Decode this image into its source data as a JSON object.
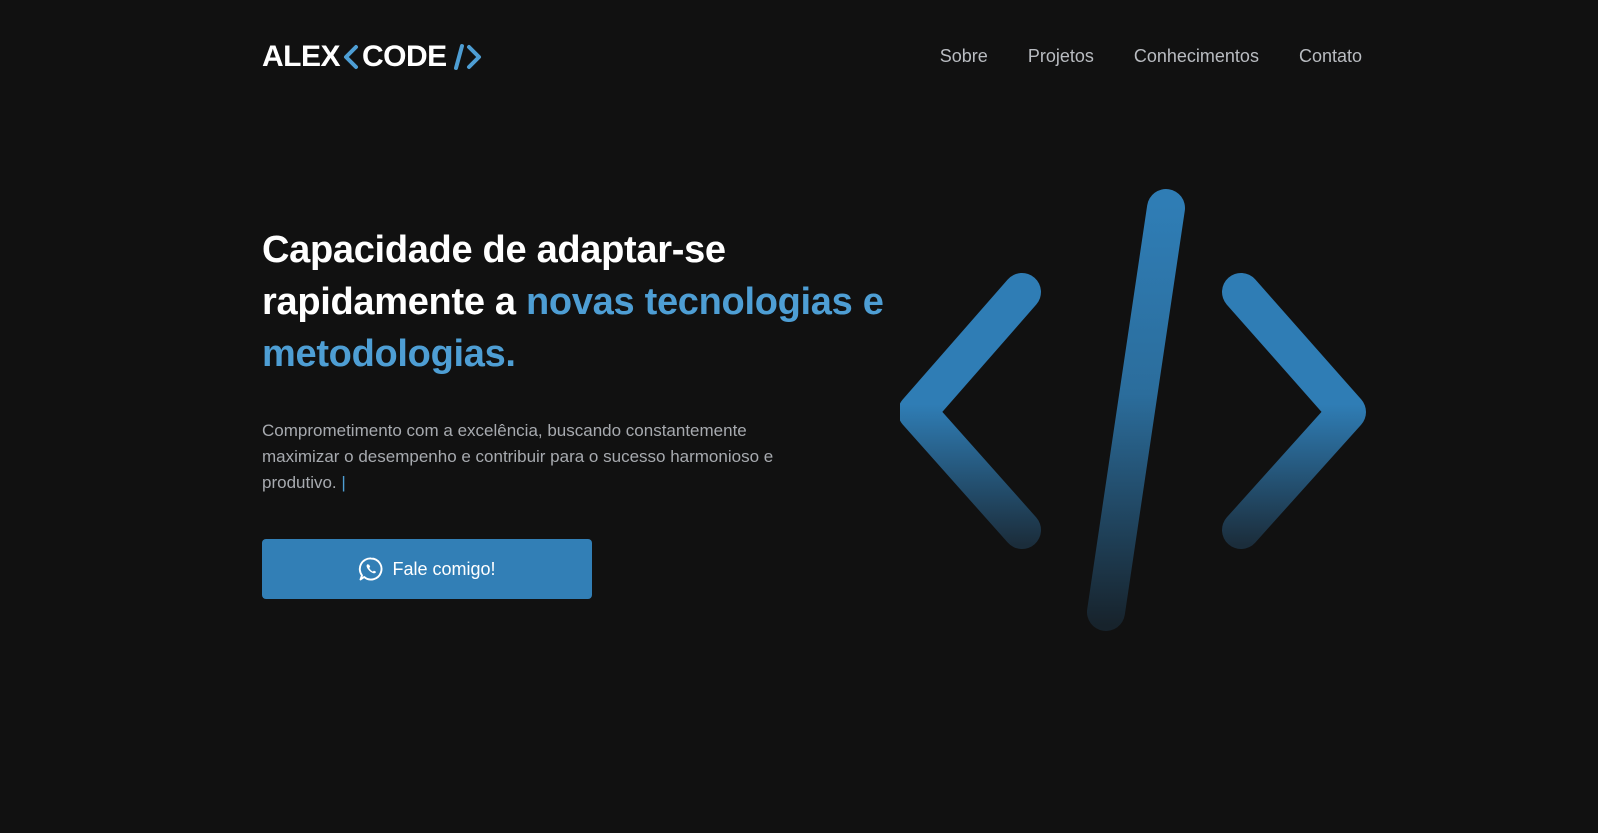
{
  "brand": {
    "name_left": "ALEX",
    "name_right": "CODE",
    "logo_icon": "code-brackets-icon",
    "accent_color": "#4e9ed4"
  },
  "nav": {
    "items": [
      {
        "label": "Sobre"
      },
      {
        "label": "Projetos"
      },
      {
        "label": "Conhecimentos"
      },
      {
        "label": "Contato"
      }
    ]
  },
  "hero": {
    "title_plain": "Capacidade de adaptar-se rapidamente a ",
    "title_accent": "novas tecnologias e metodologias.",
    "description": "Comprometimento com a excelência, buscando constantemente maximizar o desempenho e contribuir para o sucesso harmonioso e produtivo.",
    "cursor": "|",
    "cta_label": "Fale comigo!",
    "cta_icon": "whatsapp-icon",
    "illustration_icon": "code-tag-icon"
  },
  "colors": {
    "background": "#111111",
    "primary": "#327fb6",
    "accent": "#4e9ed4",
    "muted_text": "#a7aaaf"
  }
}
